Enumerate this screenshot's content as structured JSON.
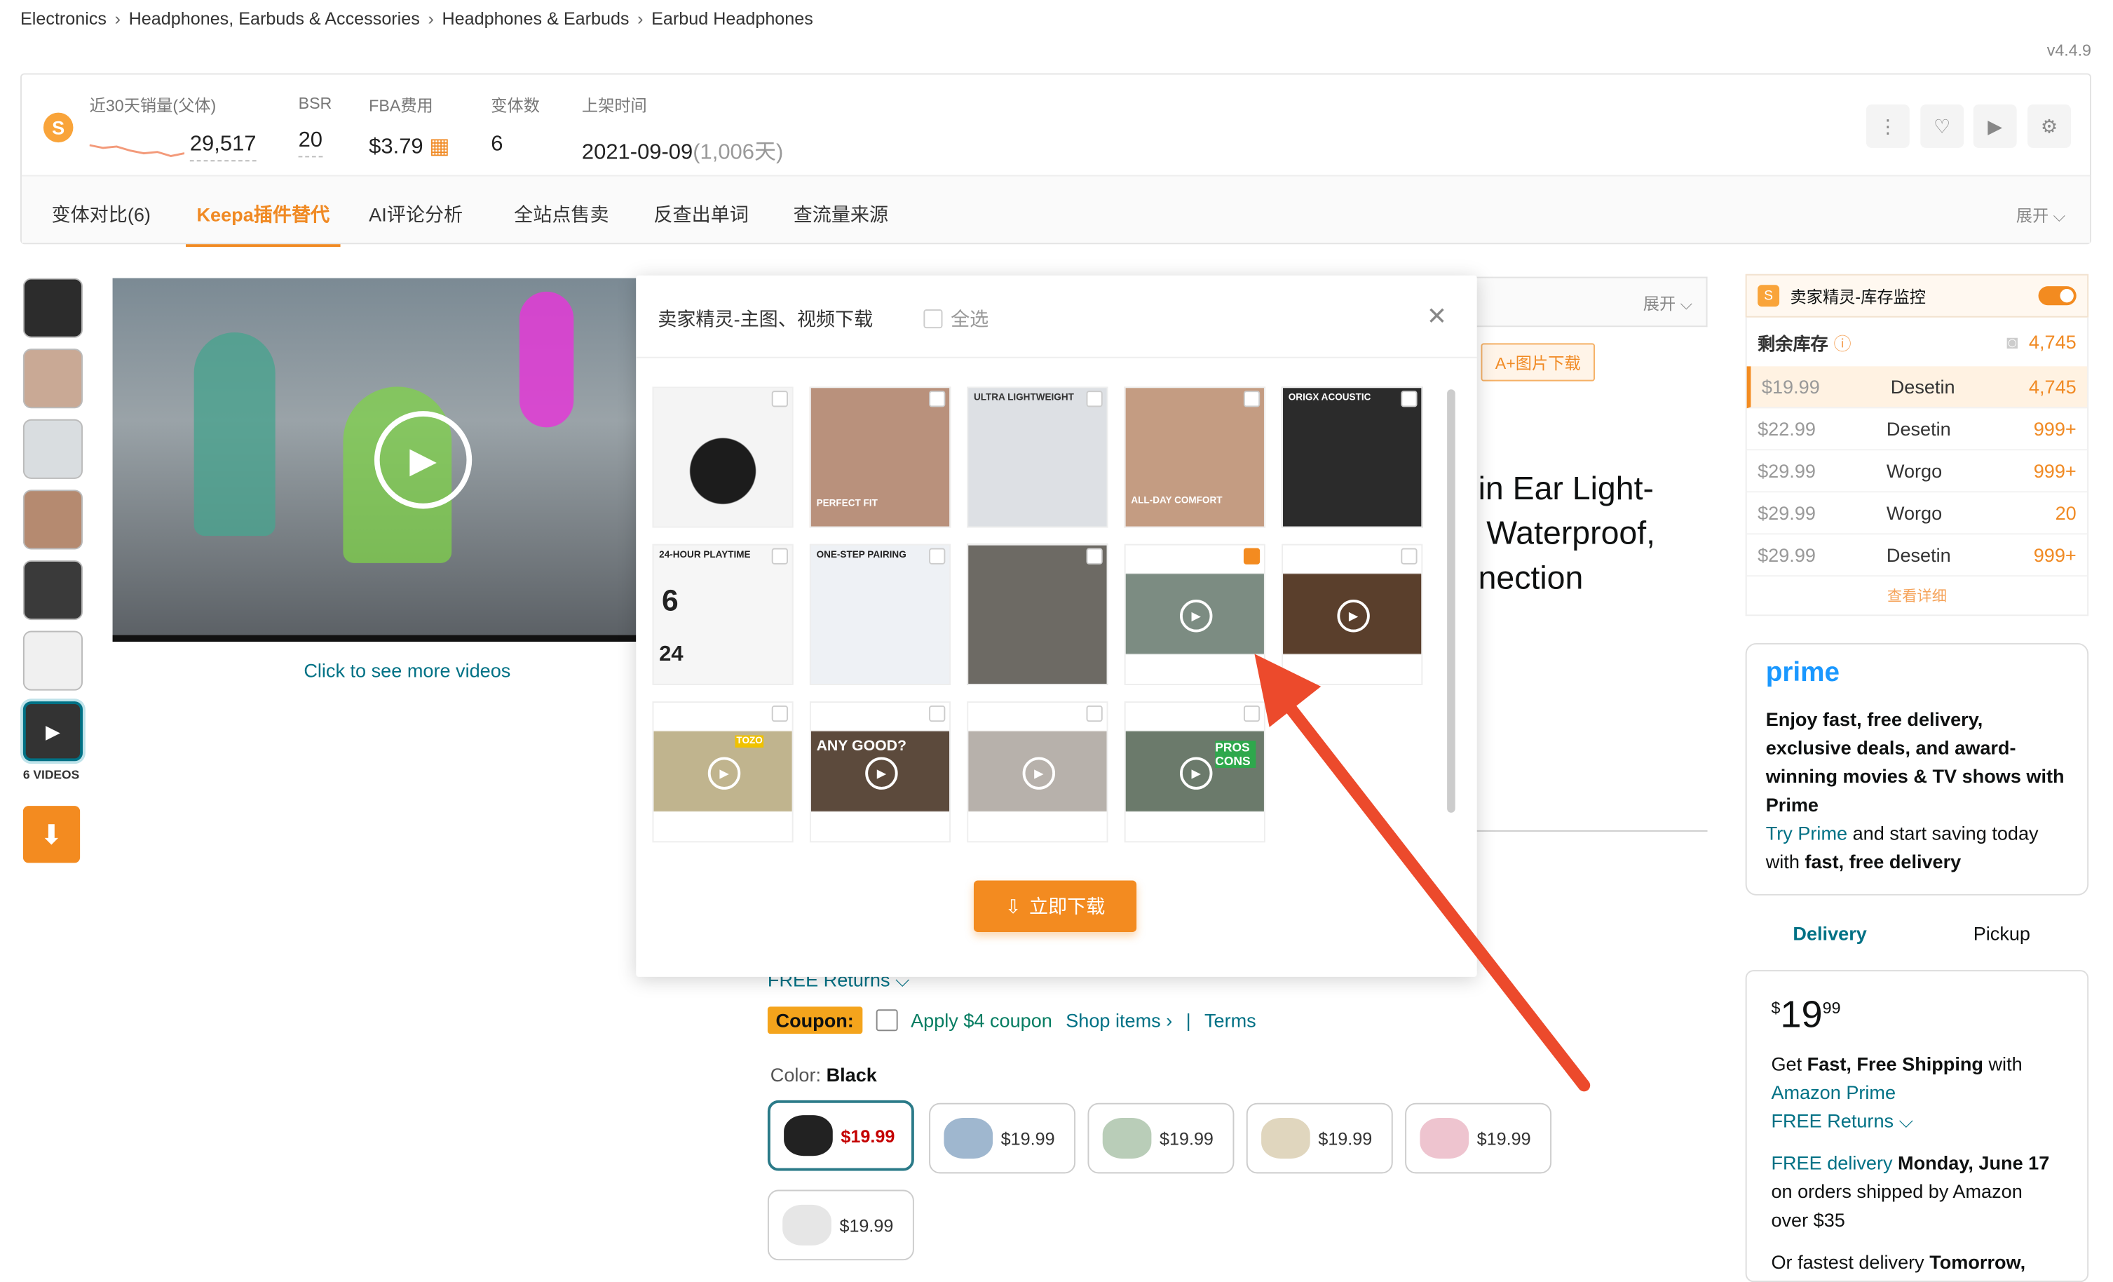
{
  "breadcrumb": [
    "Electronics",
    "Headphones, Earbuds & Accessories",
    "Headphones & Earbuds",
    "Earbud Headphones"
  ],
  "version": "v4.4.9",
  "stats": {
    "sales_label": "近30天销量(父体)",
    "sales_value": "29,517",
    "bsr_label": "BSR",
    "bsr_value": "20",
    "fba_label": "FBA费用",
    "fba_value": "$3.79",
    "variants_label": "变体数",
    "variants_value": "6",
    "listed_label": "上架时间",
    "listed_value": "2021-09-09",
    "listed_days": "(1,006天)"
  },
  "tabs": [
    "变体对比(6)",
    "Keepa插件替代",
    "AI评论分析",
    "全站点售卖",
    "反查出单词",
    "查流量来源"
  ],
  "expand": "展开",
  "gallery": {
    "videos_label": "6 VIDEOS",
    "see_more": "Click to see more videos"
  },
  "modal": {
    "title": "卖家精灵-主图、视频下载",
    "select_all": "全选",
    "download": "立即下载",
    "captions": [
      "",
      "PERFECT FIT",
      "ULTRA LIGHTWEIGHT",
      "ALL-DAY COMFORT",
      "ORIGX ACOUSTIC",
      "24-HOUR PLAYTIME",
      "ONE-STEP PAIRING",
      "",
      "",
      "",
      "TOZO",
      "ANY GOOD?",
      "",
      "PROS CONS"
    ],
    "digits": {
      "six": "6",
      "twentyfour": "24"
    }
  },
  "aplus": "A+图片下载",
  "title_lines": [
    "in Ear Light-",
    "Waterproof,",
    "nection"
  ],
  "free_returns": "FREE Returns",
  "coupon": {
    "badge": "Coupon:",
    "apply": "Apply $4 coupon",
    "shop": "Shop items ›",
    "sep": "|",
    "terms": "Terms"
  },
  "color": {
    "label": "Color:",
    "value": "Black"
  },
  "swatches": [
    "$19.99",
    "$19.99",
    "$19.99",
    "$19.99",
    "$19.99",
    "$19.99"
  ],
  "inventory": {
    "title": "卖家精灵-库存监控",
    "remaining_label": "剩余库存",
    "remaining_value": "4,745",
    "rows": [
      {
        "price": "$19.99",
        "seller": "Desetin",
        "qty": "4,745"
      },
      {
        "price": "$22.99",
        "seller": "Desetin",
        "qty": "999+"
      },
      {
        "price": "$29.99",
        "seller": "Worgo",
        "qty": "999+"
      },
      {
        "price": "$29.99",
        "seller": "Worgo",
        "qty": "20"
      },
      {
        "price": "$29.99",
        "seller": "Desetin",
        "qty": "999+"
      }
    ],
    "details": "查看详细"
  },
  "prime": {
    "logo": "prime",
    "bold": "Enjoy fast, free delivery, exclusive deals, and award-winning movies & TV shows with Prime",
    "try": "Try Prime",
    "rest": " and start saving today with ",
    "bold2": "fast, free delivery"
  },
  "delivery_tabs": [
    "Delivery",
    "Pickup"
  ],
  "buybox": {
    "currency": "$",
    "whole": "19",
    "cents": "99",
    "ship1": "Get ",
    "ship_bold": "Fast, Free Shipping",
    "ship2": " with",
    "amazon_prime": "Amazon Prime",
    "free_returns": "FREE Returns",
    "free_delivery": "FREE delivery",
    "date": "Monday, June 17",
    "orders": "on orders shipped by Amazon over $35",
    "fastest": "Or fastest delivery ",
    "tomorrow": "Tomorrow,"
  },
  "colors": {
    "accent": "#f38b20",
    "link": "#007185",
    "arrow": "#ec4a2c"
  }
}
